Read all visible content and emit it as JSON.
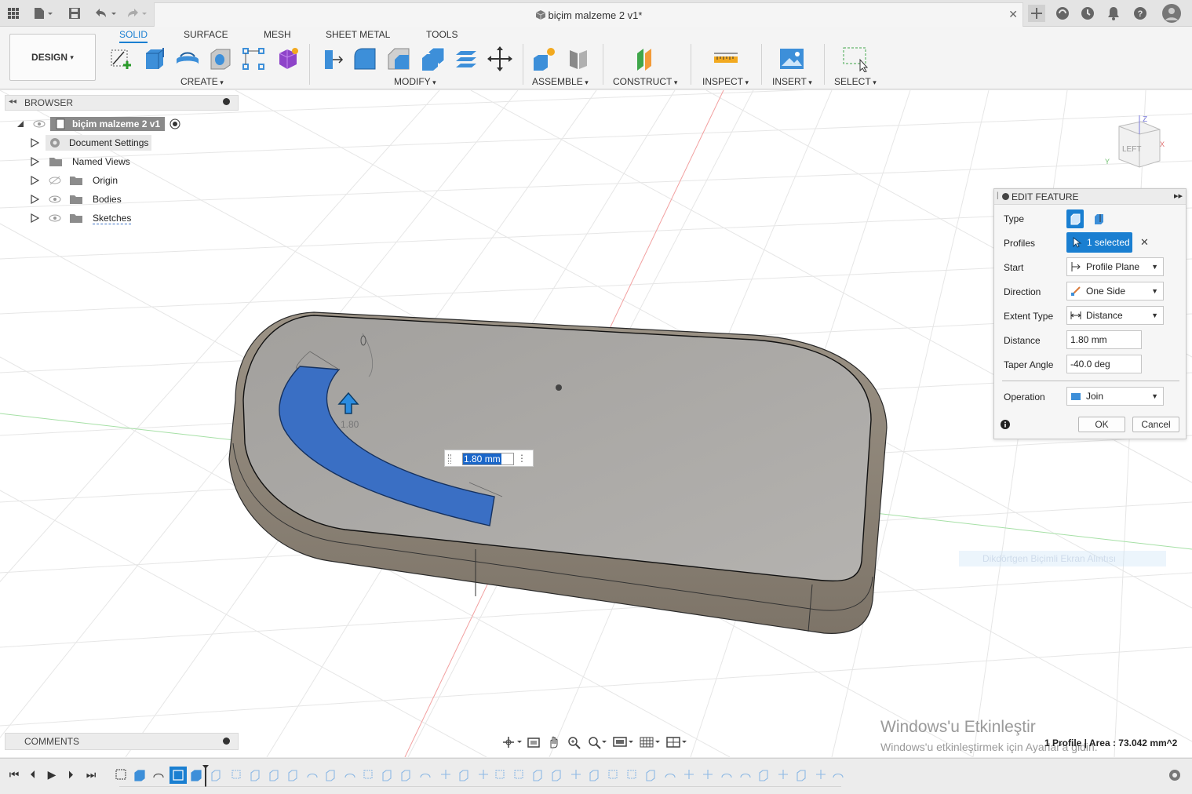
{
  "titlebar": {
    "document_title": "biçim malzeme 2 v1*"
  },
  "workspace": {
    "mode_button": "DESIGN",
    "tabs": [
      "SOLID",
      "SURFACE",
      "MESH",
      "SHEET METAL",
      "TOOLS"
    ],
    "active_tab": "SOLID",
    "groups": {
      "create": "CREATE",
      "modify": "MODIFY",
      "assemble": "ASSEMBLE",
      "construct": "CONSTRUCT",
      "inspect": "INSPECT",
      "insert": "INSERT",
      "select": "SELECT"
    }
  },
  "browser": {
    "title": "BROWSER",
    "root": "biçim malzeme 2 v1",
    "items": [
      "Document Settings",
      "Named Views",
      "Origin",
      "Bodies",
      "Sketches"
    ]
  },
  "comments": {
    "title": "COMMENTS"
  },
  "viewcube": {
    "face": "LEFT",
    "axis_z": "Z",
    "axis_x": "X",
    "axis_y": "Y"
  },
  "edit_feature": {
    "title": "EDIT FEATURE",
    "type_label": "Type",
    "profiles_label": "Profiles",
    "profiles_value": "1 selected",
    "start_label": "Start",
    "start_value": "Profile Plane",
    "direction_label": "Direction",
    "direction_value": "One Side",
    "extent_label": "Extent Type",
    "extent_value": "Distance",
    "distance_label": "Distance",
    "distance_value": "1.80 mm",
    "taper_label": "Taper Angle",
    "taper_value": "-40.0 deg",
    "operation_label": "Operation",
    "operation_value": "Join",
    "ok": "OK",
    "cancel": "Cancel"
  },
  "canvas": {
    "dimension_input": "1.80 mm",
    "arrow_label": "1.80",
    "ghost_tooltip": "Dikdörtgen Biçimli Ekran Alıntısı"
  },
  "status": {
    "selection_info": "1 Profile | Area : 73.042 mm^2"
  },
  "watermark": {
    "line1": "Windows'u Etkinleştir",
    "line2": "Windows'u etkinleştirmek için Ayarlar'a gidin."
  },
  "colors": {
    "accent": "#1a7fd1",
    "profile_fill": "#3a6fc4",
    "body_top": "#a8a6a3",
    "body_side": "#8f877c"
  }
}
